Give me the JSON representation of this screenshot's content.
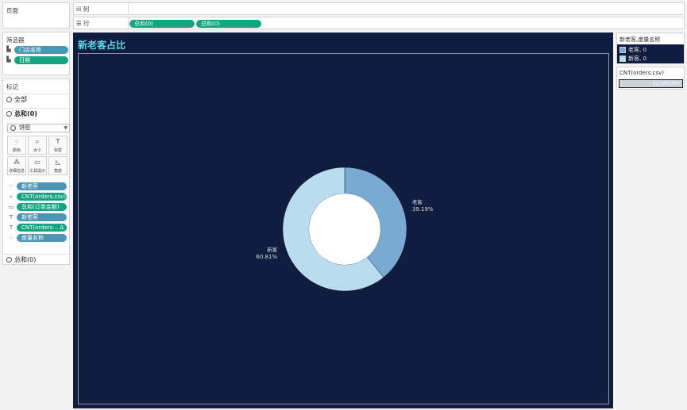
{
  "pages_panel": {
    "title": "页面"
  },
  "filters_panel": {
    "title": "筛选器",
    "filters": [
      {
        "label": "门店名称",
        "color": "#4c95b5"
      },
      {
        "label": "日期",
        "color": "#14a47f"
      }
    ]
  },
  "marks_panel": {
    "title": "标记",
    "all_label": "全部",
    "sum_label": "总和(0)",
    "mark_type": "饼图",
    "buttons": [
      {
        "label": "颜色",
        "icon": "color-icon"
      },
      {
        "label": "大小",
        "icon": "size-icon"
      },
      {
        "label": "标签",
        "icon": "label-icon"
      },
      {
        "label": "详细信息",
        "icon": "detail-icon"
      },
      {
        "label": "工具提示",
        "icon": "tooltip-icon"
      },
      {
        "label": "角度",
        "icon": "angle-icon"
      }
    ],
    "fields": [
      {
        "label": "新老客",
        "color": "#4c95b5",
        "icon": "color-icon"
      },
      {
        "label": "CNT(orders.csv)",
        "color": "#14a47f",
        "icon": "size-icon"
      },
      {
        "label": "总和(订单金额)",
        "color": "#14a47f",
        "icon": "tooltip-icon"
      },
      {
        "label": "新老客",
        "color": "#4c95b5",
        "icon": "label-icon"
      },
      {
        "label": "CNT(orders... Δ",
        "color": "#14a47f",
        "icon": "label-icon"
      },
      {
        "label": "度量名称",
        "color": "#4c95b5",
        "icon": "color-icon"
      }
    ],
    "second_sum_label": "总和(0)"
  },
  "shelves": {
    "columns_label": "列",
    "rows_label": "行",
    "rows_pills": [
      "总和(0)",
      "总和(0)"
    ]
  },
  "sheet": {
    "title": "新老客占比",
    "background": "#111d3f"
  },
  "chart_data": {
    "type": "pie",
    "style": "donut",
    "slices": [
      {
        "name": "老客",
        "percent": 39.19,
        "label": "39.19%",
        "color": "#7aaad0"
      },
      {
        "name": "新客",
        "percent": 60.81,
        "label": "60.81%",
        "color": "#b9dcee"
      }
    ]
  },
  "legend_color": {
    "title": "新老客,度量名称",
    "items": [
      {
        "label": "老客, 0",
        "color": "#7aaad0"
      },
      {
        "label": "新客, 0",
        "color": "#b9dcee"
      }
    ]
  },
  "legend_size": {
    "title": "CNT(orders.csv)",
    "value": "41,000,000"
  }
}
